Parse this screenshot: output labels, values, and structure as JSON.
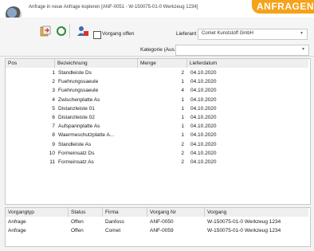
{
  "window": {
    "title": "Anfrage in neue Anfrage kopieren [ANF-0051 - W-150075-01-0 Werkzeug 1234]",
    "banner": "ANFRAGEN"
  },
  "toolbar": {
    "checkbox_label": "Vorgang offen",
    "lieferant_label": "Lieferant",
    "lieferant_value": "Comet Kunststoff GmbH",
    "kategorie_label": "Kategorie (Aus"
  },
  "grid": {
    "headers": [
      "Pos",
      "Bezeichnung",
      "Menge",
      "Lieferdatum"
    ],
    "rows": [
      {
        "pos": "1",
        "name": "Standleiste Ds",
        "qty": "2",
        "date": "04.10.2020"
      },
      {
        "pos": "2",
        "name": "Fuehrungssaeule",
        "qty": "1",
        "date": "04.10.2020"
      },
      {
        "pos": "3",
        "name": "Fuehrungssaeule",
        "qty": "4",
        "date": "04.10.2020"
      },
      {
        "pos": "4",
        "name": "Zwischenplatte As",
        "qty": "1",
        "date": "04.10.2020"
      },
      {
        "pos": "5",
        "name": "Distanzleiste 01",
        "qty": "1",
        "date": "04.10.2020"
      },
      {
        "pos": "6",
        "name": "Distanzleiste 02",
        "qty": "1",
        "date": "04.10.2020"
      },
      {
        "pos": "7",
        "name": "Aufspannplatte As",
        "qty": "1",
        "date": "04.10.2020"
      },
      {
        "pos": "8",
        "name": "Waermeschutzplatte A...",
        "qty": "1",
        "date": "04.10.2020"
      },
      {
        "pos": "9",
        "name": "Standleiste As",
        "qty": "2",
        "date": "04.10.2020"
      },
      {
        "pos": "10",
        "name": "Formeinsatz Ds",
        "qty": "2",
        "date": "04.10.2020"
      },
      {
        "pos": "11",
        "name": "Formeinsatz As",
        "qty": "2",
        "date": "04.10.2020"
      }
    ]
  },
  "grid2": {
    "headers": [
      "Vorgangtyp",
      "Status",
      "Firma",
      "Vorgang Nr",
      "Vorgang"
    ],
    "rows": [
      {
        "typ": "Anfrage",
        "status": "Offen",
        "firma": "Danfoss",
        "nr": "ANF-0050",
        "vorgang": "W-150075-01-0 Werkzeug 1234"
      },
      {
        "typ": "Anfrage",
        "status": "Offen",
        "firma": "Comet",
        "nr": "ANF-0059",
        "vorgang": "W-150075-01-0 Werkzeug 1234"
      }
    ]
  },
  "colors": {
    "banner": "#f5a21b",
    "accent": "#2b5fa8"
  },
  "icons": [
    "app-logo-icon",
    "import-icon",
    "refresh-icon",
    "user-icon"
  ]
}
